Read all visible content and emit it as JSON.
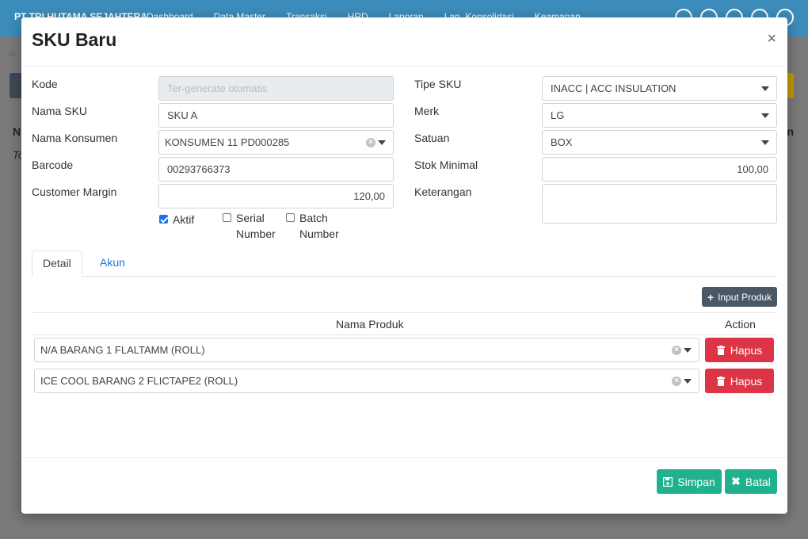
{
  "app": {
    "brand": "PT TRI HUTAMA SEJAHTERA",
    "nav": [
      "Dashboard",
      "Data Master",
      "Transaksi",
      "HRD",
      "Laporan",
      "Lap. Konsolidasi",
      "Keamanan"
    ],
    "bg_col_left": "N",
    "bg_col_right": "on",
    "bg_row_text": "To"
  },
  "modal": {
    "title": "SKU Baru",
    "close": "×",
    "form": {
      "kode": {
        "label": "Kode",
        "placeholder": "Ter-generate otomatis"
      },
      "nama_sku": {
        "label": "Nama SKU",
        "value": "SKU A"
      },
      "nama_konsumen": {
        "label": "Nama Konsumen",
        "value": "KONSUMEN 11 PD000285"
      },
      "barcode": {
        "label": "Barcode",
        "value": "00293766373"
      },
      "customer_margin": {
        "label": "Customer Margin",
        "value": "120,00"
      },
      "tipe_sku": {
        "label": "Tipe SKU",
        "value": "INACC | ACC INSULATION"
      },
      "merk": {
        "label": "Merk",
        "value": "LG"
      },
      "satuan": {
        "label": "Satuan",
        "value": "BOX"
      },
      "stok_minimal": {
        "label": "Stok Minimal",
        "value": "100,00"
      },
      "keterangan": {
        "label": "Keterangan",
        "value": ""
      },
      "checkboxes": {
        "aktif": {
          "label": "Aktif",
          "checked": true
        },
        "serial_line1": "Serial",
        "serial_line2": "Number",
        "batch_line1": "Batch",
        "batch_line2": "Number"
      }
    },
    "tabs": {
      "detail": "Detail",
      "akun": "Akun"
    },
    "table": {
      "input_button": "Input Produk",
      "col_produk": "Nama Produk",
      "col_action": "Action",
      "rows": [
        {
          "produk": "N/A BARANG 1 FLALTAMM (ROLL)",
          "hapus": "Hapus"
        },
        {
          "produk": "ICE COOL BARANG 2 FLICTAPE2 (ROLL)",
          "hapus": "Hapus"
        }
      ]
    },
    "footer": {
      "simpan": "Simpan",
      "batal": "Batal"
    }
  },
  "colors": {
    "nav": "#3c8dbc",
    "primary_link": "#1a73e8",
    "danger": "#dc3545",
    "success": "#20b28f",
    "dark_button": "#4a5866"
  }
}
